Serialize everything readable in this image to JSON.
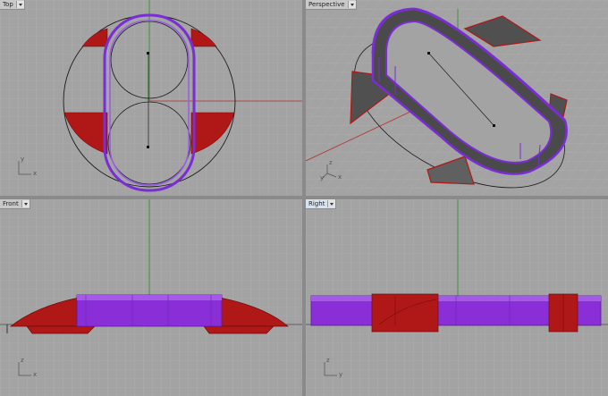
{
  "viewports": {
    "top": {
      "title": "Top",
      "axes": {
        "u": "x",
        "v": "y"
      }
    },
    "perspective": {
      "title": "Perspective",
      "axes": {
        "u": "x",
        "v": "y",
        "w": "z"
      }
    },
    "front": {
      "title": "Front",
      "axes": {
        "u": "x",
        "v": "z"
      }
    },
    "right": {
      "title": "Right",
      "axes": {
        "u": "y",
        "v": "z"
      }
    }
  },
  "active_viewport": "right",
  "colors": {
    "background": "#a3a3a3",
    "grid": "#b4b4b4",
    "selection_purple": "#7a2cd6",
    "surface_red": "#b01818",
    "x_axis": "#b23030",
    "y_axis": "#2c8a2c"
  },
  "icons": {
    "dropdown": "chevron-down-icon",
    "axes": "world-axes-icon"
  }
}
